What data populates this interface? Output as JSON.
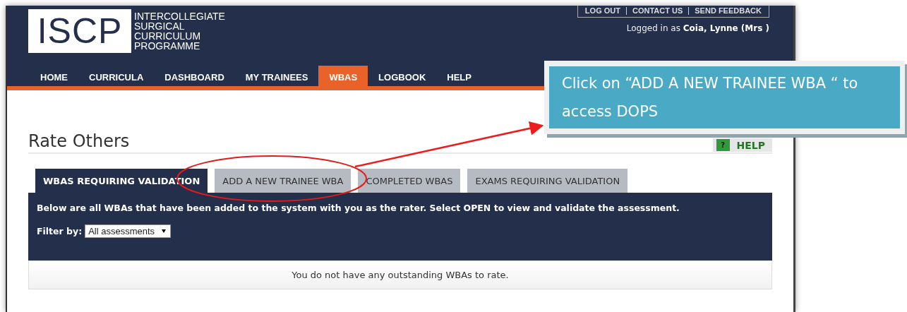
{
  "header": {
    "logo": {
      "mark": "ISCP",
      "words": [
        "INTERCOLLEGIATE",
        "SURGICAL",
        "CURRICULUM",
        "PROGRAMME"
      ]
    },
    "top_links": [
      "LOG OUT",
      "CONTACT US",
      "SEND FEEDBACK"
    ],
    "logged_in": "Logged in as **Coia, Lynne (Mrs )**",
    "nav": [
      {
        "label": "HOME",
        "selected": false
      },
      {
        "label": "CURRICULA",
        "selected": false
      },
      {
        "label": "DASHBOARD",
        "selected": false
      },
      {
        "label": "MY TRAINEES",
        "selected": false
      },
      {
        "label": "WBAS",
        "selected": true
      },
      {
        "label": "LOGBOOK",
        "selected": false
      },
      {
        "label": "HELP",
        "selected": false
      }
    ]
  },
  "page": {
    "title": "Rate Others",
    "help": {
      "icon": "?",
      "label": "HELP"
    },
    "tabs": [
      {
        "label": "WBAS REQUIRING VALIDATION",
        "selected": true
      },
      {
        "label": "ADD A NEW TRAINEE WBA",
        "selected": false
      },
      {
        "label": "COMPLETED WBAS",
        "selected": false
      },
      {
        "label": "EXAMS REQUIRING VALIDATION",
        "selected": false
      }
    ],
    "intro": "Below are all WBAs that have been added to the system with you as the rater. Select OPEN to view and validate the assessment.",
    "filter": {
      "label": "Filter by:",
      "value": "All assessments"
    },
    "empty_message": "You do not have any outstanding WBAs to rate."
  },
  "callout": {
    "text": "Click on “ADD A NEW TRAINEE WBA “ to access DOPS"
  }
}
